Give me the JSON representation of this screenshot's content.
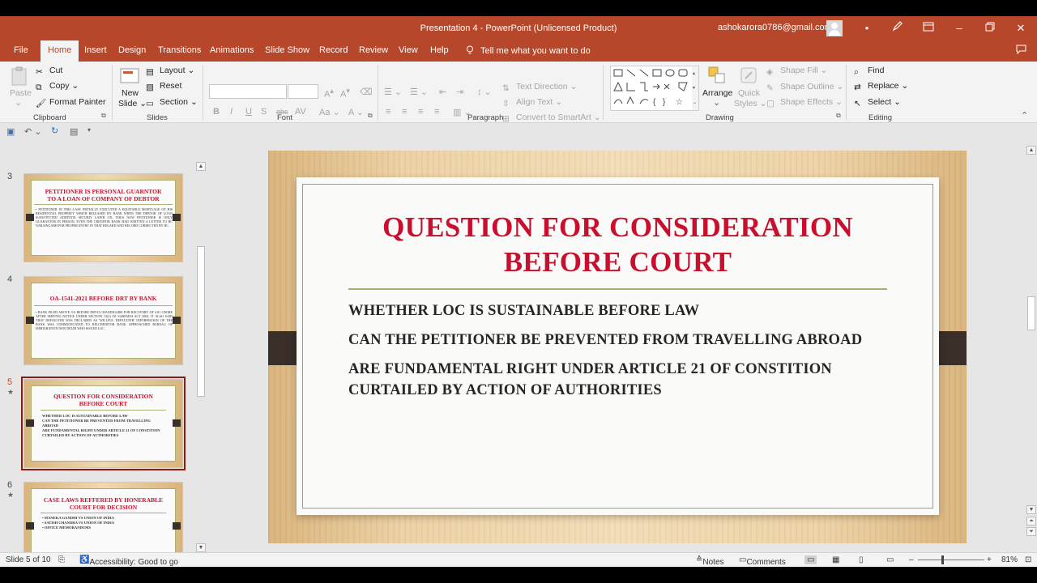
{
  "window": {
    "title": "Presentation 4  -  PowerPoint (Unlicensed Product)",
    "account": "ashokarora0786@gmail.com"
  },
  "tabs": [
    "File",
    "Home",
    "Insert",
    "Design",
    "Transitions",
    "Animations",
    "Slide Show",
    "Record",
    "Review",
    "View",
    "Help"
  ],
  "active_tab": "Home",
  "tell_me": "Tell me what you want to do",
  "ribbon": {
    "clipboard": {
      "paste": "Paste",
      "cut": "Cut",
      "copy": "Copy",
      "format_painter": "Format Painter",
      "label": "Clipboard"
    },
    "slides": {
      "new_slide_1": "New",
      "new_slide_2": "Slide",
      "layout": "Layout",
      "reset": "Reset",
      "section": "Section",
      "label": "Slides"
    },
    "font": {
      "label": "Font"
    },
    "paragraph": {
      "text_direction": "Text Direction",
      "align_text": "Align Text",
      "convert_smartart": "Convert to SmartArt",
      "label": "Paragraph"
    },
    "drawing": {
      "arrange": "Arrange",
      "quick_styles_1": "Quick",
      "quick_styles_2": "Styles",
      "shape_fill": "Shape Fill",
      "shape_outline": "Shape Outline",
      "shape_effects": "Shape Effects",
      "label": "Drawing"
    },
    "editing": {
      "find": "Find",
      "replace": "Replace",
      "select": "Select",
      "label": "Editing"
    }
  },
  "thumbnails": [
    {
      "number": "3",
      "starred": false,
      "selected": false,
      "title": "PETITIONER IS PERSONAL GUARNTOR TO A LOAN OF COMPANY OF DEBTOR",
      "body": "• PETITIONER IN THIS CASE INITIALLY EXECUTED A EQUITABLE MORTGAGE OF HIS RESIDENTIAL PROPERTY WHICH RELEASED BY BANK WHEN THE DEBTOR OF LOAN SUBSTITUTED ADDITION SECURIY LATER ON. THUS NOW PETITIONER IS ONLY GUARANTOR IN PERSON. EVEN THE CREDITOR BANK HAD WRITTEN A LETTER TO HC NARAINGARH FOR PROPER ENTRY IN THAT REGARD AND RECORD CORRECTED BY HC."
    },
    {
      "number": "4",
      "starred": false,
      "selected": false,
      "title": "OA-1541-2021 BEFORE DRT BY BANK",
      "body": "• BANK FILED ABOVE OA BEFORE DRT-II CHANDIGARH FOR RECOVERY OF 4.81 CRORE AFTER SERVING NOTICE UNDER SECTION 13(2) OF SARFAESI ACT 2002. IT ALSO SAID THAT DEFAULTER WAS DECLARED AS 'WILLFUL DEFAULTER' INFORMATION OF THE BANK WAS COMMUNICATED TO RELCREDITOR BANK APPROACHED BUREAU OF IMMIGRATION NEW DELHI WHO ISSUED LOC."
    },
    {
      "number": "5",
      "starred": true,
      "selected": true,
      "title": "QUESTION FOR CONSIDERATION BEFORE COURT",
      "body_lines": [
        "WHETHER LOC IS SUSTAINABLE BEFORE LAW",
        "CAN THE PETITIONER BE PREVENTED FROM TRAVELLING ABROAD",
        "ARE FUNDAMENTAL RIGHT UNDER ARTICLE 21 OF CONSTITION CURTAILED BY ACTION OF AUTHORITIES"
      ]
    },
    {
      "number": "6",
      "starred": true,
      "selected": false,
      "title": "CASE LAWS REFFERED BY HONERABLE COURT FOR DECISION",
      "body_lines": [
        "• MANEKA GANDHI VS UNION OF INDIA",
        "• SATISH CHANDRA VS UNION OF INDIA",
        "• OFFICE MEMORANDUMS"
      ]
    }
  ],
  "slide": {
    "title_line1": "QUESTION FOR CONSIDERATION",
    "title_line2": "BEFORE COURT",
    "points": [
      "WHETHER LOC IS SUSTAINABLE BEFORE LAW",
      "CAN THE PETITIONER BE PREVENTED FROM TRAVELLING ABROAD",
      "ARE FUNDAMENTAL RIGHT UNDER ARTICLE 21 OF CONSTITION CURTAILED BY ACTION OF AUTHORITIES"
    ]
  },
  "status": {
    "slide_of": "Slide 5 of 10",
    "accessibility": "Accessibility: Good to go",
    "notes": "Notes",
    "comments": "Comments",
    "zoom": "81%"
  },
  "colors": {
    "accent": "#b7472a",
    "slide_title": "#c8102e"
  }
}
